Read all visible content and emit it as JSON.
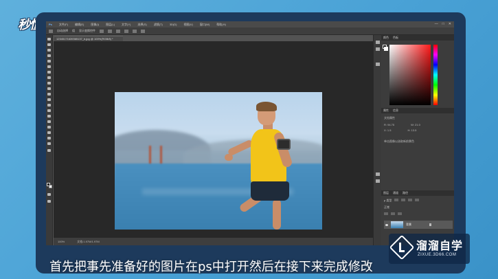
{
  "overlay": {
    "logo_text": "秒懂视频",
    "subtitle": "首先把事先准备好的图片在ps中打开然后在接下来完成修改",
    "watermark_title": "溜溜自学",
    "watermark_url": "ZIXUE.3D66.COM"
  },
  "photoshop": {
    "menu": [
      "文件(F)",
      "编辑(E)",
      "图像(I)",
      "图层(L)",
      "文字(Y)",
      "选择(S)",
      "滤镜(T)",
      "3D(D)",
      "视图(V)",
      "窗口(W)",
      "帮助(H)"
    ],
    "window_controls": [
      "—",
      "□",
      "✕"
    ],
    "options_bar": {
      "auto_select": "自动选择",
      "layer_dropdown": "组",
      "show_transform": "显示变换控件"
    },
    "document_tab": "12345171639365137_b.jpg @ 100%(RGB/8) *",
    "status": {
      "zoom": "100%",
      "doc_size": "文档:1.97M/1.97M"
    },
    "panels": {
      "color_tabs": [
        "颜色",
        "色板"
      ],
      "info_tabs": [
        "属性",
        "信息"
      ],
      "info_label": "文档属性",
      "info_values": [
        "R: 94.75",
        "X: 1.5",
        "W: 21.0",
        "H: 13.5"
      ],
      "info_note": "单击图像以选取新前景色",
      "layers_tabs": [
        "图层",
        "通道",
        "路径"
      ],
      "layer_kind": "p 类型",
      "layer_mode": "正常",
      "layer_name": "背景"
    }
  },
  "colors": {
    "ps_bg": "#535353",
    "canvas_bg": "#282828",
    "accent_blue": "#1d3a5c"
  }
}
